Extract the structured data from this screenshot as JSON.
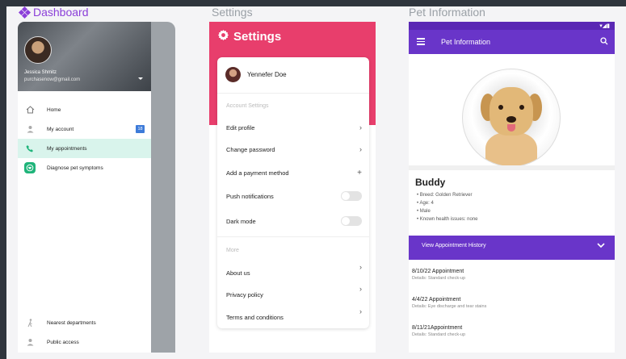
{
  "headings": {
    "dashboard": "Dashboard",
    "settings": "Settings",
    "pet_information": "Pet Information"
  },
  "dashboard": {
    "user_name": "Jessica Shmitz",
    "user_email": "purchasenow@gmail.com",
    "items": [
      {
        "label": "Home",
        "icon": "home-icon"
      },
      {
        "label": "My account",
        "icon": "person-icon",
        "badge": "18"
      },
      {
        "label": "My appointments",
        "icon": "phone-icon"
      },
      {
        "label": "Diagnose pet symptoms",
        "icon": "heart-shield-icon"
      }
    ],
    "bottom_items": [
      {
        "label": "Nearest departments",
        "icon": "walk-icon"
      },
      {
        "label": "Public access",
        "icon": "person-icon"
      }
    ],
    "accent_color": "#1fb47a"
  },
  "settings": {
    "title": "Settings",
    "profile_name": "Yennefer Doe",
    "section_account": "Account Settings",
    "account_rows": [
      {
        "label": "Edit profile",
        "control": "chevron"
      },
      {
        "label": "Change password",
        "control": "chevron"
      },
      {
        "label": "Add a payment method",
        "control": "plus"
      },
      {
        "label": "Push notifications",
        "control": "toggle",
        "on": false
      },
      {
        "label": "Dark mode",
        "control": "toggle",
        "on": false
      }
    ],
    "section_more": "More",
    "more_rows": [
      {
        "label": "About us"
      },
      {
        "label": "Privacy policy"
      },
      {
        "label": "Terms and conditions"
      }
    ],
    "header_color": "#e83e6c"
  },
  "pet": {
    "appbar_title": "Pet Information",
    "name": "Buddy",
    "details": [
      "Breed: Golden Retriever",
      "Age: 4",
      "Male",
      "Known health issues: none"
    ],
    "history_label": "View Appointment History",
    "appointments": [
      {
        "title": "8/10/22 Appointment",
        "detail": "Details: Standard check-up"
      },
      {
        "title": "4/4/22 Appointment",
        "detail": "Details: Eye discharge and tear stains"
      },
      {
        "title": "8/11/21Appointment",
        "detail": "Details: Standard check-up"
      }
    ],
    "brand_color": "#6935c9"
  }
}
